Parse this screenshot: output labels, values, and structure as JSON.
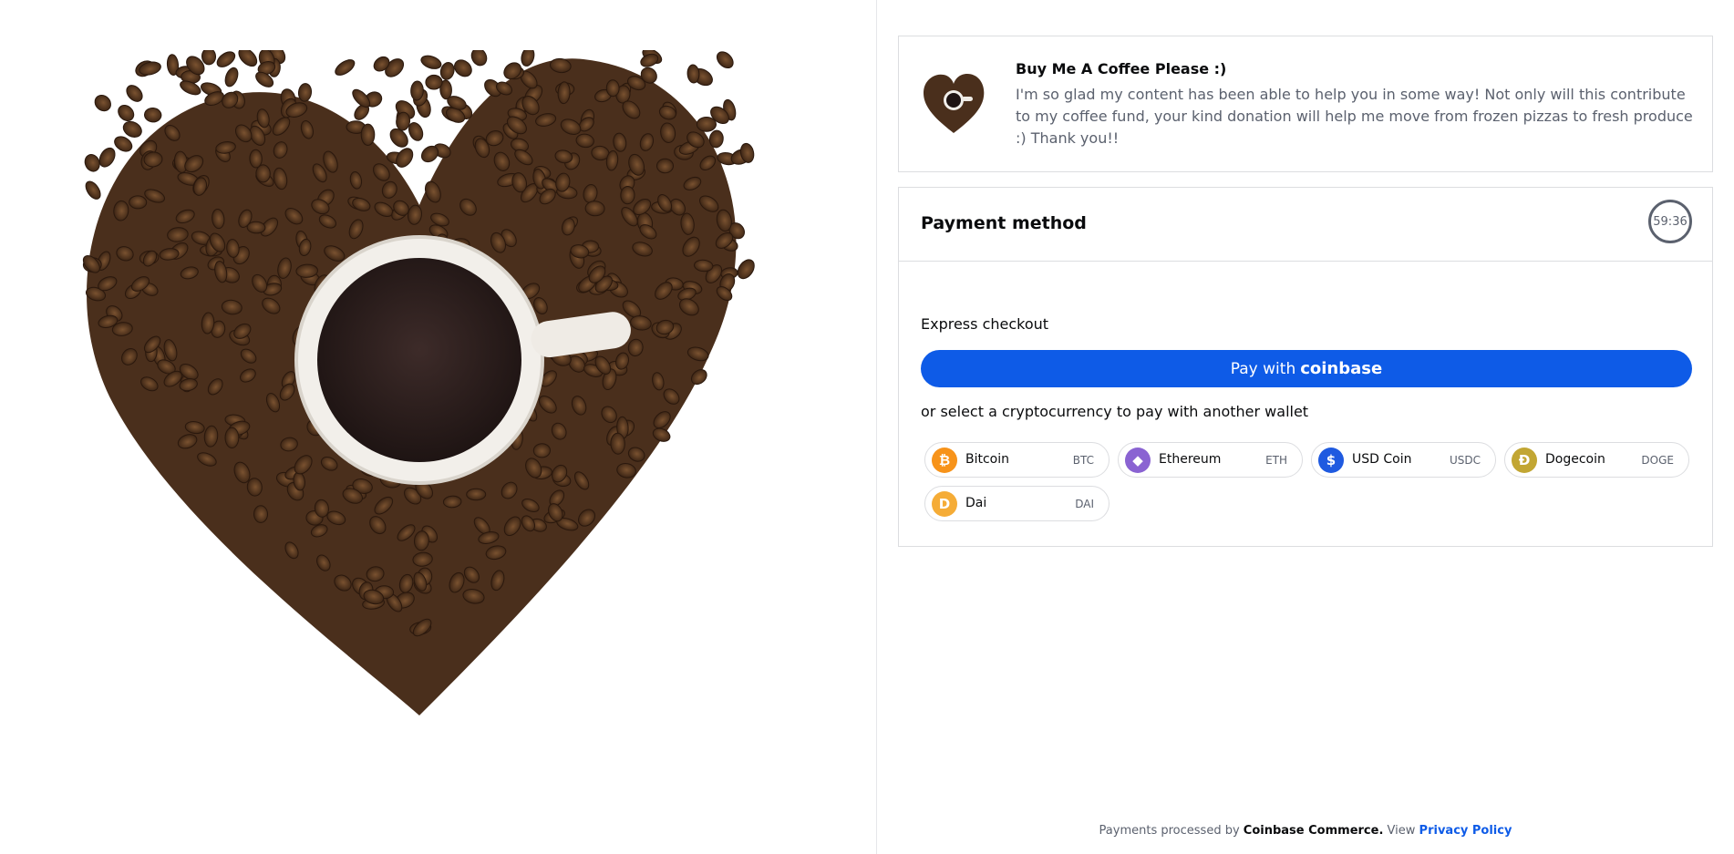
{
  "merchant": {
    "title": "Buy Me A Coffee Please :)",
    "description": "I'm so glad my content has been able to help you in some way! Not only will this contribute to my coffee fund, your kind donation will help me move from frozen pizzas to fresh produce :) Thank you!!",
    "image_icon": "coffee-heart-image"
  },
  "payment": {
    "title": "Payment method",
    "timer": "59:36",
    "express_label": "Express checkout",
    "pay_button_prefix": "Pay with",
    "pay_button_brand": "coinbase",
    "or_label": "or select a cryptocurrency to pay with another wallet",
    "currencies": [
      {
        "name": "Bitcoin",
        "ticker": "BTC",
        "color": "#f7931a",
        "glyph": "₿"
      },
      {
        "name": "Ethereum",
        "ticker": "ETH",
        "color": "#8a63d2",
        "glyph": "◆"
      },
      {
        "name": "USD Coin",
        "ticker": "USDC",
        "color": "#1f5ae0",
        "glyph": "$"
      },
      {
        "name": "Dogecoin",
        "ticker": "DOGE",
        "color": "#c2a633",
        "glyph": "Ð"
      },
      {
        "name": "Dai",
        "ticker": "DAI",
        "color": "#f5ac37",
        "glyph": "D"
      }
    ]
  },
  "footer": {
    "prefix": "Payments processed by",
    "company": "Coinbase Commerce.",
    "view": "View",
    "privacy_link": "Privacy Policy"
  },
  "colors": {
    "accent": "#0e5be7",
    "muted_text": "#5b616e",
    "border": "#dcdde0"
  }
}
